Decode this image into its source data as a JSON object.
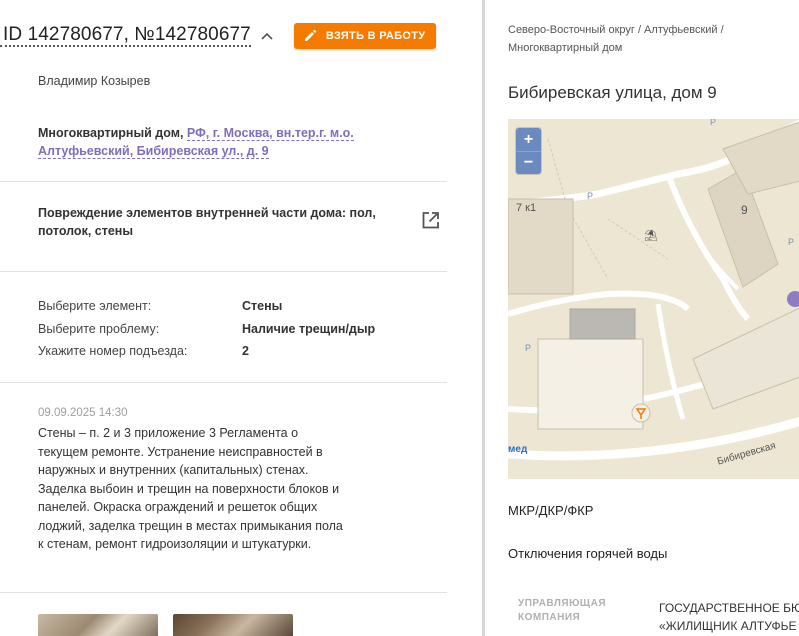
{
  "ticket": {
    "id_text": "ID 142780677, №142780677",
    "take_button_label": "ВЗЯТЬ В РАБОТУ",
    "author": "Владимир Козырев",
    "object_type": "Многоквартирный дом,",
    "address_link": "РФ, г. Москва, вн.тер.г. м.о. Алтуфьевский, Бибиревская ул., д. 9",
    "category": "Повреждение элементов внутренней части дома: пол, потолок, стены",
    "params": [
      {
        "label": "Выберите элемент:",
        "value": "Стены"
      },
      {
        "label": "Выберите проблему:",
        "value": "Наличие трещин/дыр"
      },
      {
        "label": "Укажите номер подъезда:",
        "value": "2"
      }
    ],
    "comment_date": "09.09.2025 14:30",
    "comment_text": "Стены – п. 2 и 3 приложение 3 Регламента о текущем ремонте. Устранение неисправностей в наружных и внутренних (капитальных) стенах. Заделка выбоин и трещин на поверхности блоков и панелей. Окраска ограждений и решеток общих лоджий, заделка трещин в местах примыкания пола к стенам, ремонт гидроизоляции и штукатурки."
  },
  "house": {
    "breadcrumb": "Северо-Восточный округ / Алтуфьевский / Многоквартирный дом",
    "title": "Бибиревская улица, дом 9",
    "map": {
      "zoom_in": "+",
      "zoom_out": "−",
      "label_building_7k1": "7 к1",
      "label_building_9": "9",
      "label_street": "Бибиревская",
      "label_metro": "мед",
      "parking_label": "P"
    },
    "section_mkd": "МКР/ДКР/ФКР",
    "section_hot_water": "Отключения горячей воды",
    "management_label": "УПРАВЛЯЮЩАЯ КОМПАНИЯ",
    "management_value_line1": "ГОСУДАРСТВЕННОЕ БЮ",
    "management_value_line2": "«ЖИЛИЩНИК АЛТУФЬЕ"
  },
  "colors": {
    "accent_orange": "#f47b00",
    "link_purple": "#7c6fbf",
    "map_bg": "#ede6d3",
    "zoom_blue": "#6b8bc0"
  }
}
